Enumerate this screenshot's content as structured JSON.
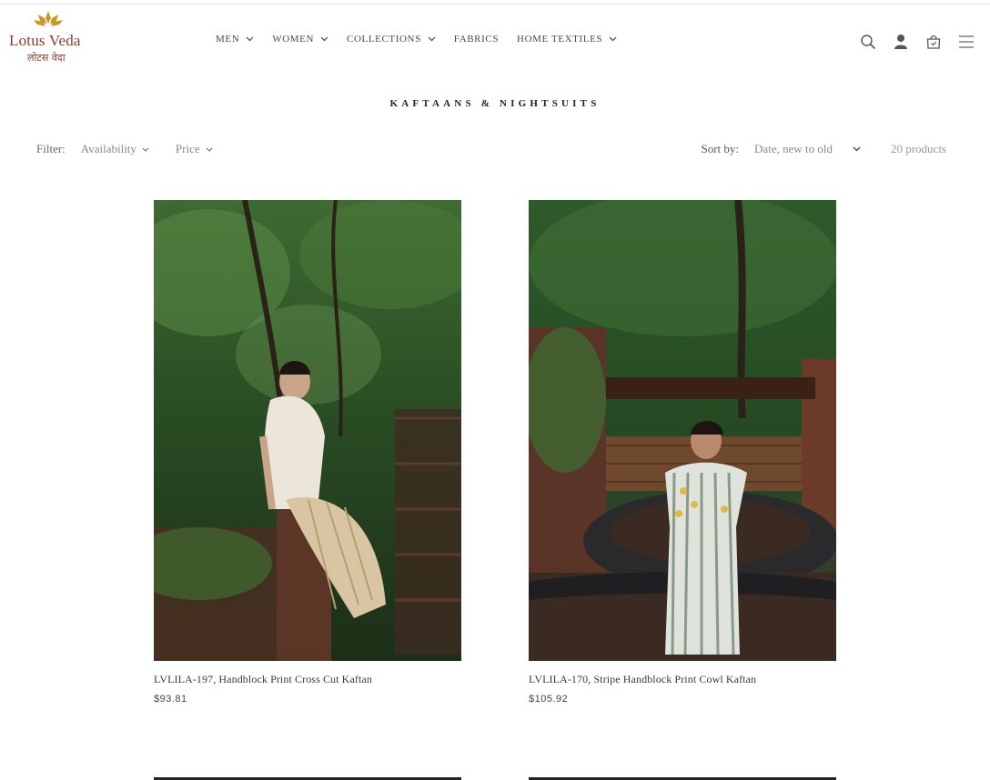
{
  "header": {
    "logo": {
      "name": "Lotus Veda",
      "sub": "लोटस वेदा"
    },
    "nav": [
      {
        "label": "MEN",
        "has_dropdown": true
      },
      {
        "label": "WOMEN",
        "has_dropdown": true
      },
      {
        "label": "COLLECTIONS",
        "has_dropdown": true
      },
      {
        "label": "FABRICS",
        "has_dropdown": false
      },
      {
        "label": "HOME TEXTILES",
        "has_dropdown": true
      }
    ],
    "icons": [
      "search-icon",
      "account-icon",
      "cart-icon",
      "menu-icon"
    ]
  },
  "page": {
    "title": "KAFTAANS & NIGHTSUITS"
  },
  "filters": {
    "label": "Filter:",
    "availability": "Availability",
    "price": "Price",
    "sort_label": "Sort by:",
    "sort_value": "Date, new to old",
    "count": "20 products"
  },
  "products": [
    {
      "title": "LVLILA-197, Handblock Print Cross Cut Kaftan",
      "price": "$93.81"
    },
    {
      "title": "LVLILA-170, Stripe Handblock Print Cowl Kaftan",
      "price": "$105.92"
    }
  ],
  "colors": {
    "brand": "#8b3a2e",
    "logo_gold": "#c9962b",
    "text": "#3a3a3a"
  }
}
